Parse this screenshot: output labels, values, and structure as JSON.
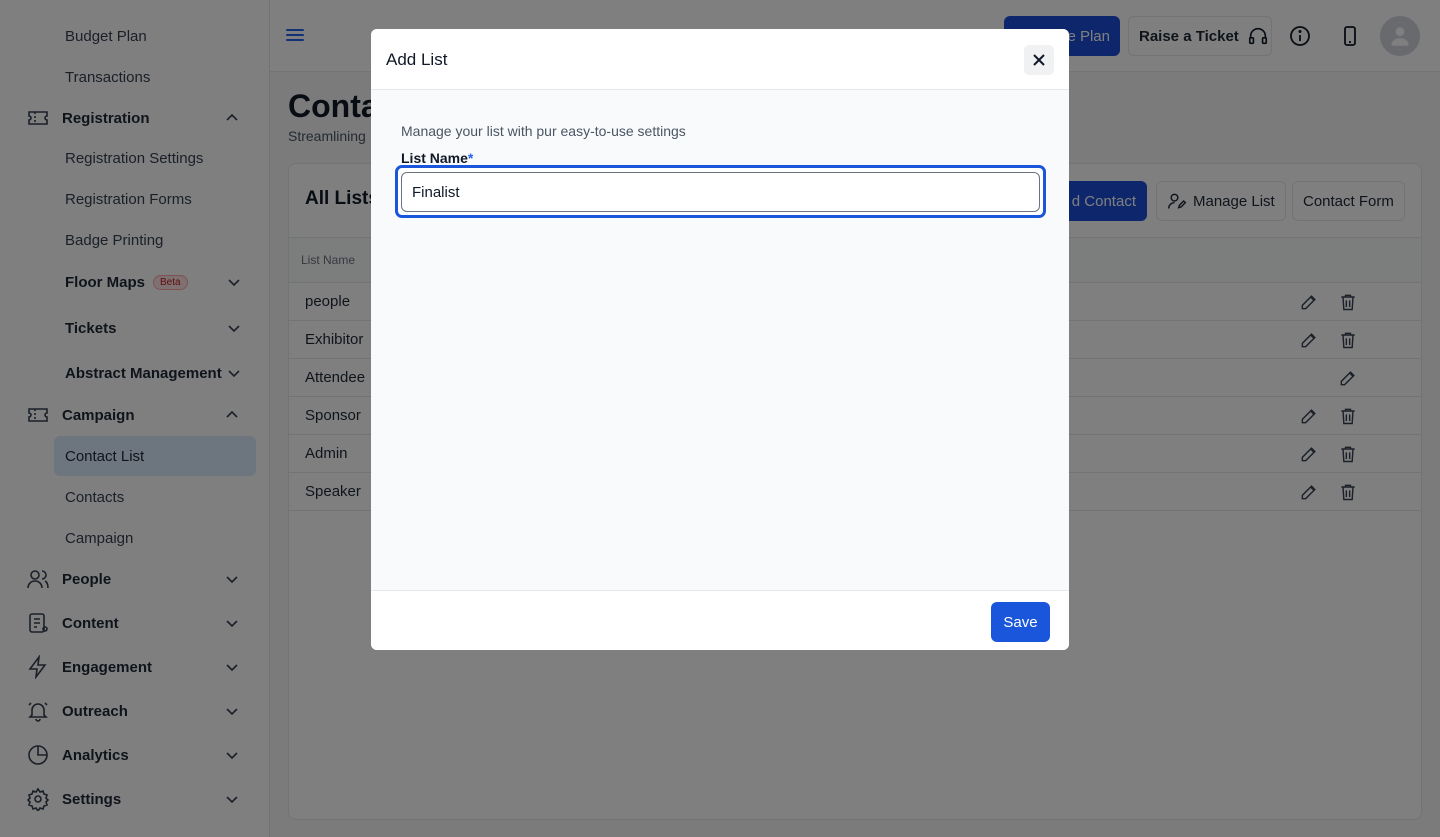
{
  "sidebar": {
    "items": [
      {
        "label": "Budget Plan"
      },
      {
        "label": "Transactions"
      },
      {
        "label": "Registration"
      },
      {
        "label": "Registration Settings"
      },
      {
        "label": "Registration Forms"
      },
      {
        "label": "Badge Printing"
      },
      {
        "label": "Floor Maps",
        "badge": "Beta"
      },
      {
        "label": "Tickets"
      },
      {
        "label": "Abstract Management"
      },
      {
        "label": "Campaign"
      },
      {
        "label": "Contact List"
      },
      {
        "label": "Contacts"
      },
      {
        "label": "Campaign"
      },
      {
        "label": "People"
      },
      {
        "label": "Content"
      },
      {
        "label": "Engagement"
      },
      {
        "label": "Outreach"
      },
      {
        "label": "Analytics"
      },
      {
        "label": "Settings"
      }
    ]
  },
  "topbar": {
    "plan_button": "e Plan",
    "ticket_button": "Raise a Ticket",
    "icons": [
      "menu-icon",
      "headset-icon",
      "info-icon",
      "phone-icon",
      "user-avatar-icon"
    ]
  },
  "main": {
    "title": "Conta",
    "subtitle": "Streamlining",
    "card_title": "All Lists",
    "actions": {
      "add_contact": "d Contact",
      "manage_list": "Manage List",
      "contact_form": "Contact Form"
    },
    "table": {
      "header": "List Name",
      "rows": [
        "people",
        "Exhibitor",
        "Attendee",
        "Sponsor",
        "Admin",
        "Speaker"
      ]
    }
  },
  "modal": {
    "title": "Add List",
    "description": "Manage your list with pur easy-to-use settings",
    "field_label": "List Name",
    "required_mark": "*",
    "field_value": "Finalist",
    "save_label": "Save"
  },
  "colors": {
    "accent": "#1a56db",
    "overlay": "rgba(0,0,0,0.5)"
  }
}
